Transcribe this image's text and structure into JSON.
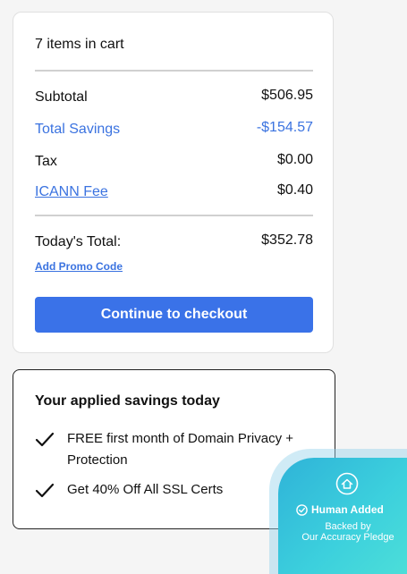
{
  "cart": {
    "items_count": "7 items in cart",
    "subtotal_label": "Subtotal",
    "subtotal_value": "$506.95",
    "savings_label": "Total Savings",
    "savings_value": "-$154.57",
    "tax_label": "Tax",
    "tax_value": "$0.00",
    "fee_label": "ICANN Fee",
    "fee_value": "$0.40",
    "total_label": "Today's Total:",
    "total_value": "$352.78",
    "promo_label": "Add Promo Code",
    "checkout_label": "Continue to checkout"
  },
  "savings": {
    "title": "Your applied savings today",
    "items": [
      {
        "text": "FREE first month of Domain Privacy + Protection",
        "icon": "check-icon"
      },
      {
        "text": "Get 40% Off All SSL Certs",
        "icon": "check-icon"
      }
    ]
  },
  "badge": {
    "title": "Human Added",
    "line1": "Backed by",
    "line2": "Our Accuracy Pledge",
    "icon": "home-shield-icon"
  },
  "colors": {
    "accent": "#3b73e0",
    "button": "#3a72e8",
    "badge_gradient_start": "#2fb3d8",
    "badge_gradient_end": "#4ee0d8"
  }
}
